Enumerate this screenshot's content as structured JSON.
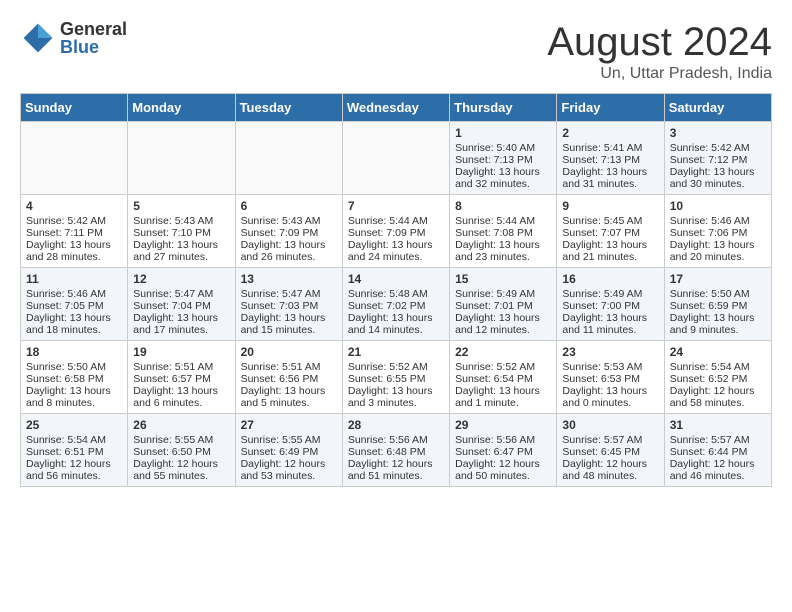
{
  "logo": {
    "general": "General",
    "blue": "Blue"
  },
  "title": {
    "month": "August 2024",
    "location": "Un, Uttar Pradesh, India"
  },
  "days_of_week": [
    "Sunday",
    "Monday",
    "Tuesday",
    "Wednesday",
    "Thursday",
    "Friday",
    "Saturday"
  ],
  "weeks": [
    [
      {
        "day": "",
        "info": ""
      },
      {
        "day": "",
        "info": ""
      },
      {
        "day": "",
        "info": ""
      },
      {
        "day": "",
        "info": ""
      },
      {
        "day": "1",
        "info": "Sunrise: 5:40 AM\nSunset: 7:13 PM\nDaylight: 13 hours\nand 32 minutes."
      },
      {
        "day": "2",
        "info": "Sunrise: 5:41 AM\nSunset: 7:13 PM\nDaylight: 13 hours\nand 31 minutes."
      },
      {
        "day": "3",
        "info": "Sunrise: 5:42 AM\nSunset: 7:12 PM\nDaylight: 13 hours\nand 30 minutes."
      }
    ],
    [
      {
        "day": "4",
        "info": "Sunrise: 5:42 AM\nSunset: 7:11 PM\nDaylight: 13 hours\nand 28 minutes."
      },
      {
        "day": "5",
        "info": "Sunrise: 5:43 AM\nSunset: 7:10 PM\nDaylight: 13 hours\nand 27 minutes."
      },
      {
        "day": "6",
        "info": "Sunrise: 5:43 AM\nSunset: 7:09 PM\nDaylight: 13 hours\nand 26 minutes."
      },
      {
        "day": "7",
        "info": "Sunrise: 5:44 AM\nSunset: 7:09 PM\nDaylight: 13 hours\nand 24 minutes."
      },
      {
        "day": "8",
        "info": "Sunrise: 5:44 AM\nSunset: 7:08 PM\nDaylight: 13 hours\nand 23 minutes."
      },
      {
        "day": "9",
        "info": "Sunrise: 5:45 AM\nSunset: 7:07 PM\nDaylight: 13 hours\nand 21 minutes."
      },
      {
        "day": "10",
        "info": "Sunrise: 5:46 AM\nSunset: 7:06 PM\nDaylight: 13 hours\nand 20 minutes."
      }
    ],
    [
      {
        "day": "11",
        "info": "Sunrise: 5:46 AM\nSunset: 7:05 PM\nDaylight: 13 hours\nand 18 minutes."
      },
      {
        "day": "12",
        "info": "Sunrise: 5:47 AM\nSunset: 7:04 PM\nDaylight: 13 hours\nand 17 minutes."
      },
      {
        "day": "13",
        "info": "Sunrise: 5:47 AM\nSunset: 7:03 PM\nDaylight: 13 hours\nand 15 minutes."
      },
      {
        "day": "14",
        "info": "Sunrise: 5:48 AM\nSunset: 7:02 PM\nDaylight: 13 hours\nand 14 minutes."
      },
      {
        "day": "15",
        "info": "Sunrise: 5:49 AM\nSunset: 7:01 PM\nDaylight: 13 hours\nand 12 minutes."
      },
      {
        "day": "16",
        "info": "Sunrise: 5:49 AM\nSunset: 7:00 PM\nDaylight: 13 hours\nand 11 minutes."
      },
      {
        "day": "17",
        "info": "Sunrise: 5:50 AM\nSunset: 6:59 PM\nDaylight: 13 hours\nand 9 minutes."
      }
    ],
    [
      {
        "day": "18",
        "info": "Sunrise: 5:50 AM\nSunset: 6:58 PM\nDaylight: 13 hours\nand 8 minutes."
      },
      {
        "day": "19",
        "info": "Sunrise: 5:51 AM\nSunset: 6:57 PM\nDaylight: 13 hours\nand 6 minutes."
      },
      {
        "day": "20",
        "info": "Sunrise: 5:51 AM\nSunset: 6:56 PM\nDaylight: 13 hours\nand 5 minutes."
      },
      {
        "day": "21",
        "info": "Sunrise: 5:52 AM\nSunset: 6:55 PM\nDaylight: 13 hours\nand 3 minutes."
      },
      {
        "day": "22",
        "info": "Sunrise: 5:52 AM\nSunset: 6:54 PM\nDaylight: 13 hours\nand 1 minute."
      },
      {
        "day": "23",
        "info": "Sunrise: 5:53 AM\nSunset: 6:53 PM\nDaylight: 13 hours\nand 0 minutes."
      },
      {
        "day": "24",
        "info": "Sunrise: 5:54 AM\nSunset: 6:52 PM\nDaylight: 12 hours\nand 58 minutes."
      }
    ],
    [
      {
        "day": "25",
        "info": "Sunrise: 5:54 AM\nSunset: 6:51 PM\nDaylight: 12 hours\nand 56 minutes."
      },
      {
        "day": "26",
        "info": "Sunrise: 5:55 AM\nSunset: 6:50 PM\nDaylight: 12 hours\nand 55 minutes."
      },
      {
        "day": "27",
        "info": "Sunrise: 5:55 AM\nSunset: 6:49 PM\nDaylight: 12 hours\nand 53 minutes."
      },
      {
        "day": "28",
        "info": "Sunrise: 5:56 AM\nSunset: 6:48 PM\nDaylight: 12 hours\nand 51 minutes."
      },
      {
        "day": "29",
        "info": "Sunrise: 5:56 AM\nSunset: 6:47 PM\nDaylight: 12 hours\nand 50 minutes."
      },
      {
        "day": "30",
        "info": "Sunrise: 5:57 AM\nSunset: 6:45 PM\nDaylight: 12 hours\nand 48 minutes."
      },
      {
        "day": "31",
        "info": "Sunrise: 5:57 AM\nSunset: 6:44 PM\nDaylight: 12 hours\nand 46 minutes."
      }
    ]
  ]
}
